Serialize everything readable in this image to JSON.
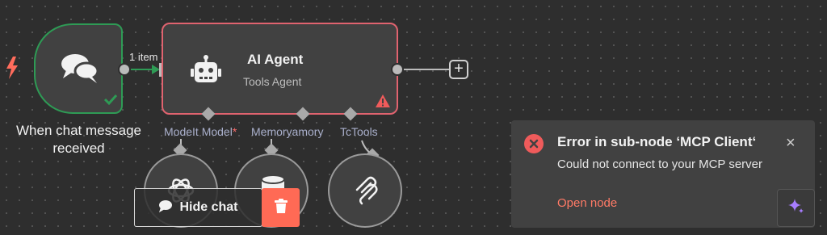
{
  "trigger_node": {
    "title_line1": "When chat message",
    "title_line2": "received"
  },
  "connection": {
    "item_count_label": "1 item"
  },
  "agent_node": {
    "title": "AI Agent",
    "subtitle": "Tools Agent"
  },
  "sub_inputs": {
    "model_label": "ModeIt Model",
    "model_required": "*",
    "memory_label": "Memoryamory",
    "tools_label": "TcTools"
  },
  "canvas_buttons": {
    "hide_chat_label": "Hide chat"
  },
  "toast": {
    "title": "Error in sub-node ‘MCP Client‘",
    "message": "Could not connect to your MCP server",
    "link": "Open node",
    "close_symbol": "×"
  },
  "colors": {
    "canvas": "#2e2e2e",
    "node_bg": "#414141",
    "success": "#2e9b55",
    "error": "#e0636f",
    "link": "#ff7a66",
    "delete": "#ff6a55",
    "assistant": "#a77dff"
  },
  "icons": {
    "trigger": "lightning-icon",
    "chat_node": "chat-bubbles-icon",
    "agent": "robot-icon",
    "warning": "warning-triangle-icon",
    "success": "check-icon",
    "model": "openai-icon",
    "memory": "database-icon",
    "tools": "mcp-icon",
    "toast": "error-x-icon",
    "assistant": "sparkle-icon",
    "delete": "trash-icon"
  }
}
